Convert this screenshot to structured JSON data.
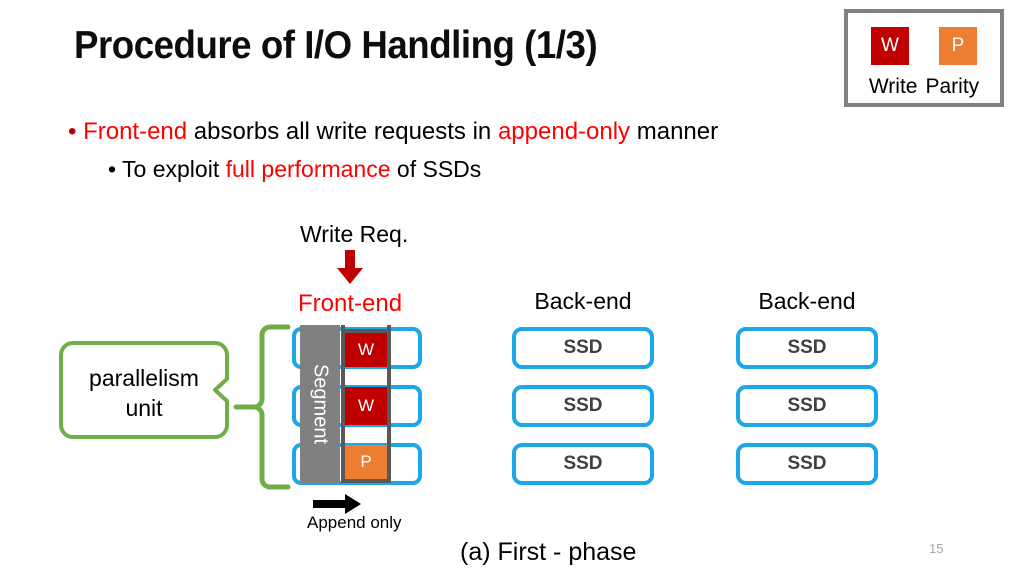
{
  "slide": {
    "title": "Procedure of I/O Handling (1/3)",
    "page_number": "15"
  },
  "legend": {
    "write_square": "W",
    "parity_square": "P",
    "write_label": "Write",
    "parity_label": "Parity",
    "write_color": "#C00000",
    "parity_color": "#ED7D31",
    "border_color": "#808080"
  },
  "bullets": {
    "bullet_marker": "•",
    "level1": {
      "highlight_1": "Front-end",
      "text_1": " absorbs all write requests in ",
      "highlight_2": "append-only",
      "text_2": " manner"
    },
    "level2": {
      "text_1": "To exploit ",
      "highlight_1": "full performance",
      "text_2": " of SSDs"
    },
    "highlight_color": "#FF0000"
  },
  "diagram": {
    "write_request_label": "Write Req.",
    "write_request_arrow": "down-arrow-icon",
    "frontend_label": "Front-end",
    "frontend_label_color": "#FF0000",
    "segment_label": "Segment",
    "segment_color": "#808080",
    "frontend_blocks": [
      {
        "label": "W",
        "type": "write"
      },
      {
        "label": "W",
        "type": "write"
      },
      {
        "label": "P",
        "type": "parity"
      }
    ],
    "callout": {
      "line1": "parallelism",
      "line2": "unit",
      "color": "#70AD47"
    },
    "append_label": "Append only",
    "append_arrow": "right-arrow-icon",
    "backends": [
      {
        "label": "Back-end",
        "devices": [
          "SSD",
          "SSD",
          "SSD"
        ]
      },
      {
        "label": "Back-end",
        "devices": [
          "SSD",
          "SSD",
          "SSD"
        ]
      }
    ],
    "box_border_color": "#1BA7E8",
    "caption": "(a) First - phase"
  }
}
